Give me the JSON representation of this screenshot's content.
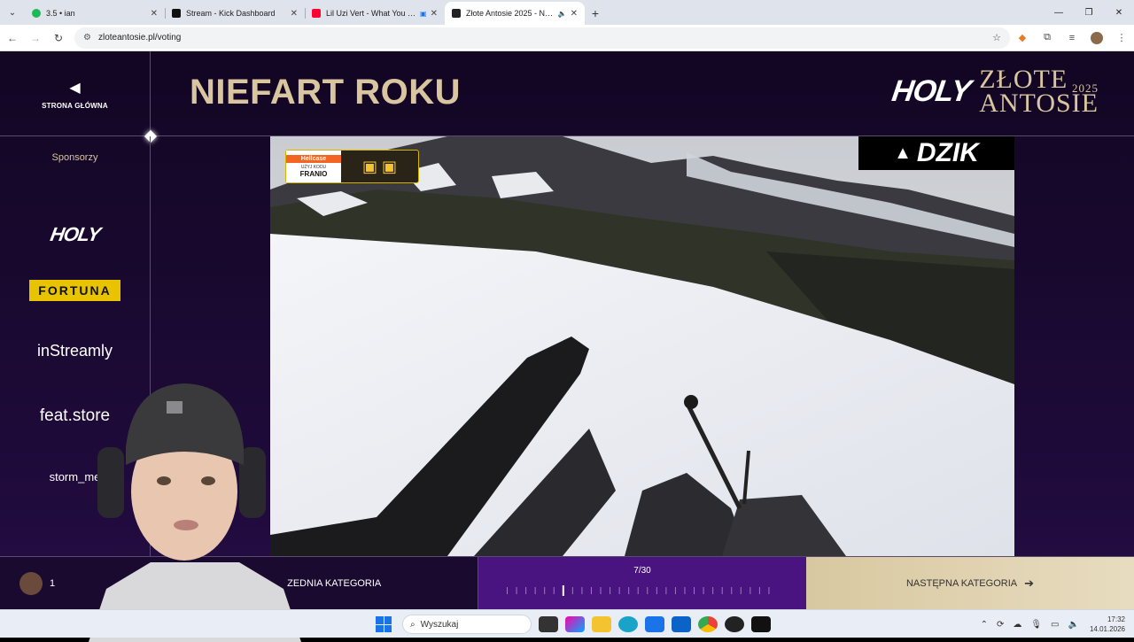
{
  "browser": {
    "tabs": [
      {
        "title": "3.5 • ian",
        "favicon_color": "#1db954"
      },
      {
        "title": "Stream - Kick Dashboard",
        "favicon_color": "#111111"
      },
      {
        "title": "Lil Uzi Vert - What You Sayin",
        "favicon_color": "#ff0033"
      },
      {
        "title": "Złote Antosie 2025 - Najwię",
        "favicon_color": "#222222"
      }
    ],
    "active_tab": 3,
    "url": "zloteantosie.pl/voting"
  },
  "header": {
    "home_label": "STRONA GŁÓWNA",
    "category_title": "NIEFART ROKU",
    "brand_holy": "HOLY",
    "brand_line1": "ZŁOTE",
    "brand_line2": "ANTOSIE",
    "brand_year": "2025"
  },
  "sidebar": {
    "title": "Sponsorzy",
    "sponsors": [
      "HOLY",
      "FORTUNA",
      "inStreamly",
      "feat.store",
      "storm_me"
    ]
  },
  "video": {
    "dzik_label": "DZIK",
    "hellcase_brand": "Hellcase",
    "hellcase_code_label": "UŻYJ KODU",
    "hellcase_code": "FRANIO"
  },
  "footer": {
    "prev_num": "1",
    "prev_label": "ZEDNIA KATEGORIA",
    "progress_text": "7/30",
    "progress_current": 7,
    "progress_total": 30,
    "next_label": "NASTĘPNA KATEGORIA"
  },
  "taskbar": {
    "search_placeholder": "Wyszukaj",
    "time": "17:32",
    "date": "14.01.2026"
  }
}
